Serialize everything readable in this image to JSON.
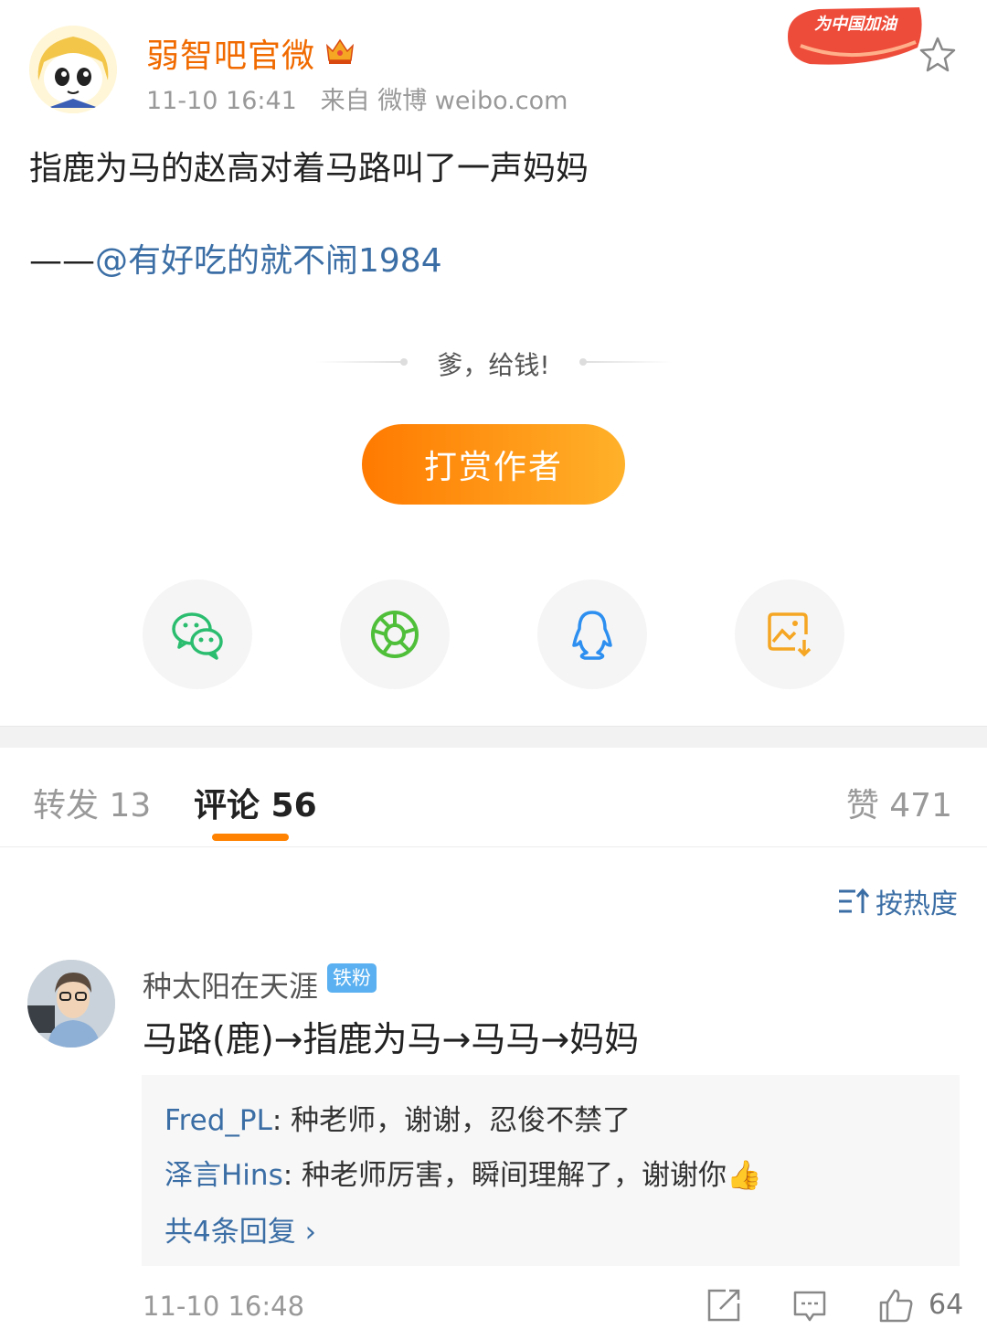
{
  "post": {
    "author": "弱智吧官微",
    "timestamp": "11-10 16:41",
    "source": "来自 微博 weibo.com",
    "badge_text": "为中国加油",
    "text": "指鹿为马的赵高对着马路叫了一声妈妈",
    "attribution_prefix": "——",
    "attribution_mention": "@有好吃的就不闹1984"
  },
  "reward": {
    "prompt": "爹，给钱!",
    "button_label": "打赏作者"
  },
  "share": {
    "icons": [
      "wechat-icon",
      "moments-icon",
      "qq-icon",
      "save-image-icon"
    ]
  },
  "tabs": {
    "repost": "转发 13",
    "comments": "评论 56",
    "likes": "赞 471"
  },
  "sort": {
    "label": "按热度"
  },
  "comment": {
    "author": "种太阳在天涯",
    "fan_badge": "铁粉",
    "text": "马路(鹿)→指鹿为马→马马→妈妈",
    "replies": [
      {
        "name": "Fred_PL",
        "text": ": 种老师，谢谢，忍俊不禁了"
      },
      {
        "name": "泽言Hins",
        "text": ": 种老师厉害，瞬间理解了，谢谢你👍"
      }
    ],
    "more_replies": "共4条回复 ›",
    "timestamp": "11-10 16:48",
    "like_count": "64"
  },
  "colors": {
    "accent": "#ff8200",
    "username": "#f06a00",
    "link": "#3b6ea5"
  }
}
